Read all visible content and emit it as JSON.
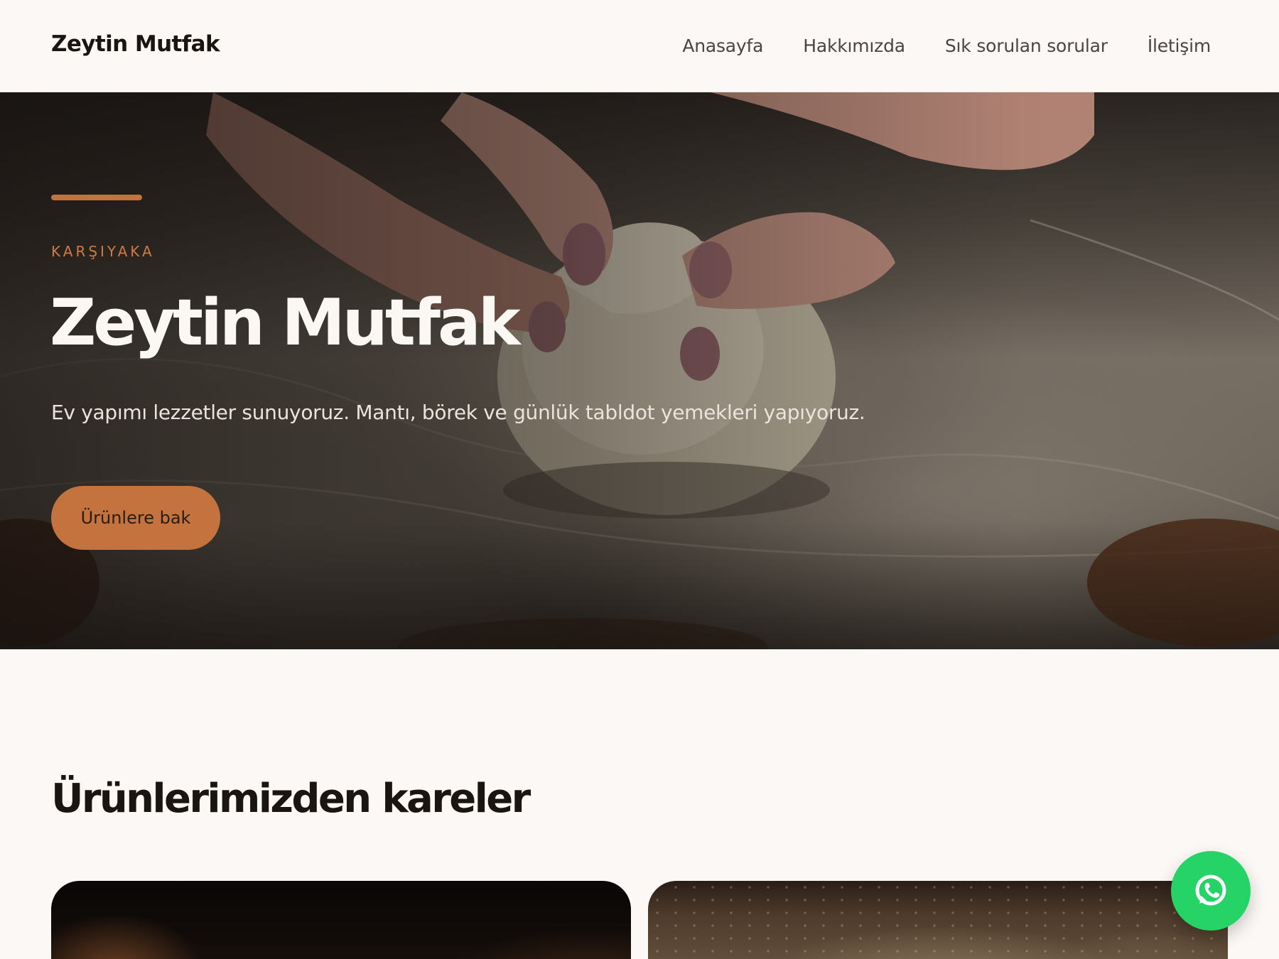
{
  "header": {
    "brand": "Zeytin Mutfak",
    "nav": [
      {
        "label": "Anasayfa"
      },
      {
        "label": "Hakkımızda"
      },
      {
        "label": "Sık sorulan sorular"
      },
      {
        "label": "İletişim"
      }
    ]
  },
  "hero": {
    "eyebrow": "KARŞIYAKA",
    "title": "Zeytin Mutfak",
    "subtitle": "Ev yapımı lezzetler sunuyoruz. Mantı, börek ve günlük tabldot yemekleri yapıyoruz.",
    "cta_label": "Ürünlere bak"
  },
  "products": {
    "title": "Ürünlerimizden kareler"
  },
  "colors": {
    "accent": "#c4733f",
    "background": "#fcf8f5",
    "whatsapp": "#25d366"
  },
  "icons": {
    "floating_button": "whatsapp-icon"
  }
}
